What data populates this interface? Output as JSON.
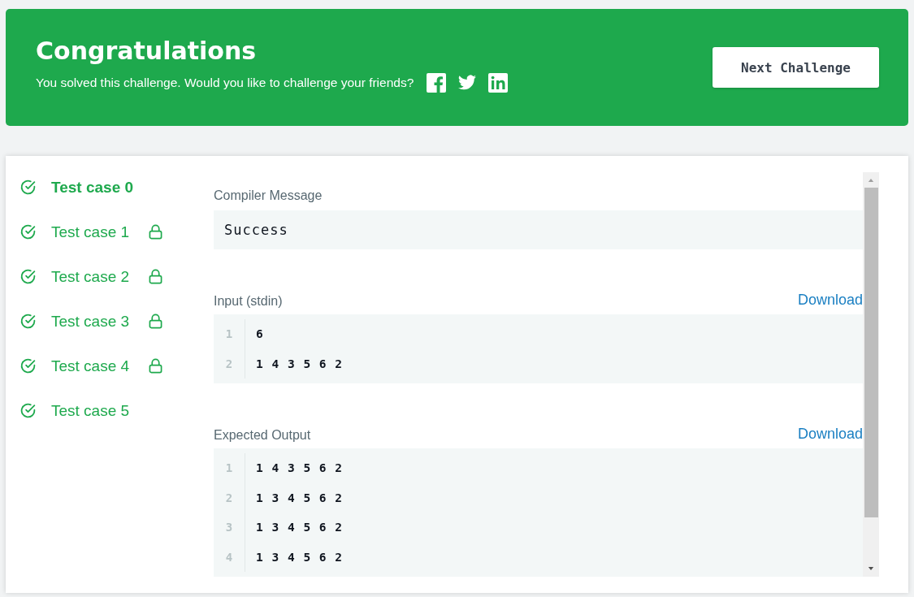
{
  "banner": {
    "title": "Congratulations",
    "message": "You solved this challenge. Would you like to challenge your friends?",
    "button": "Next Challenge"
  },
  "test_cases": [
    {
      "label": "Test case 0",
      "selected": true,
      "locked": false
    },
    {
      "label": "Test case 1",
      "selected": false,
      "locked": true
    },
    {
      "label": "Test case 2",
      "selected": false,
      "locked": true
    },
    {
      "label": "Test case 3",
      "selected": false,
      "locked": true
    },
    {
      "label": "Test case 4",
      "selected": false,
      "locked": true
    },
    {
      "label": "Test case 5",
      "selected": false,
      "locked": false
    }
  ],
  "compiler_message": {
    "label": "Compiler Message",
    "value": "Success"
  },
  "input": {
    "label": "Input (stdin)",
    "download": "Download",
    "lines": [
      {
        "number": "1",
        "text": "6"
      },
      {
        "number": "2",
        "text": "1 4 3 5 6 2"
      }
    ]
  },
  "expected_output": {
    "label": "Expected Output",
    "download": "Download",
    "lines": [
      {
        "number": "1",
        "text": "1 4 3 5 6 2"
      },
      {
        "number": "2",
        "text": "1 3 4 5 6 2"
      },
      {
        "number": "3",
        "text": "1 3 4 5 6 2"
      },
      {
        "number": "4",
        "text": "1 3 4 5 6 2"
      }
    ]
  }
}
